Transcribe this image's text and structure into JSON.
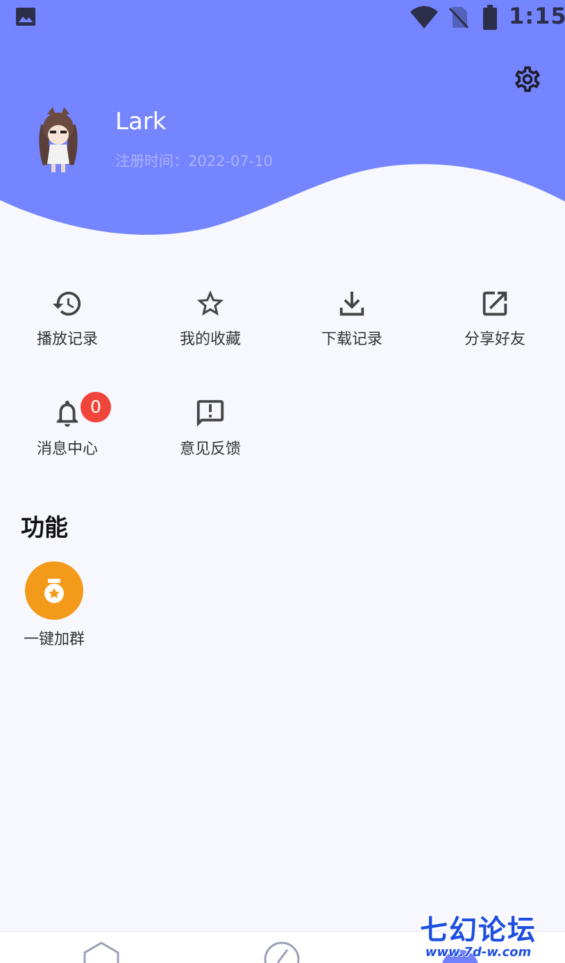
{
  "status_bar": {
    "time": "1:15",
    "icons": [
      "gallery-icon",
      "wifi-icon",
      "no-sim-icon",
      "battery-icon"
    ]
  },
  "profile": {
    "username": "Lark",
    "reg_date": "注册时间：2022-07-10"
  },
  "menu": {
    "items": [
      {
        "label": "播放记录",
        "icon": "history-icon"
      },
      {
        "label": "我的收藏",
        "icon": "star-icon"
      },
      {
        "label": "下载记录",
        "icon": "download-icon"
      },
      {
        "label": "分享好友",
        "icon": "share-icon"
      },
      {
        "label": "消息中心",
        "icon": "bell-icon",
        "badge": "0"
      },
      {
        "label": "意见反馈",
        "icon": "feedback-icon"
      }
    ]
  },
  "functions": {
    "title": "功能",
    "items": [
      {
        "label": "一键加群",
        "icon": "medal-icon"
      }
    ]
  },
  "bottom_nav": {
    "items": [
      {
        "icon": "home-icon"
      },
      {
        "icon": "discover-icon"
      },
      {
        "icon": "me-icon",
        "active": true
      }
    ]
  },
  "watermark": {
    "title": "七幻论坛",
    "url": "www.7d-w.com"
  },
  "colors": {
    "header": "#7585ff",
    "background": "#f7f8fe",
    "badge": "#f0453a",
    "function_icon": "#f39a1a",
    "watermark": "#1f4fe0"
  }
}
